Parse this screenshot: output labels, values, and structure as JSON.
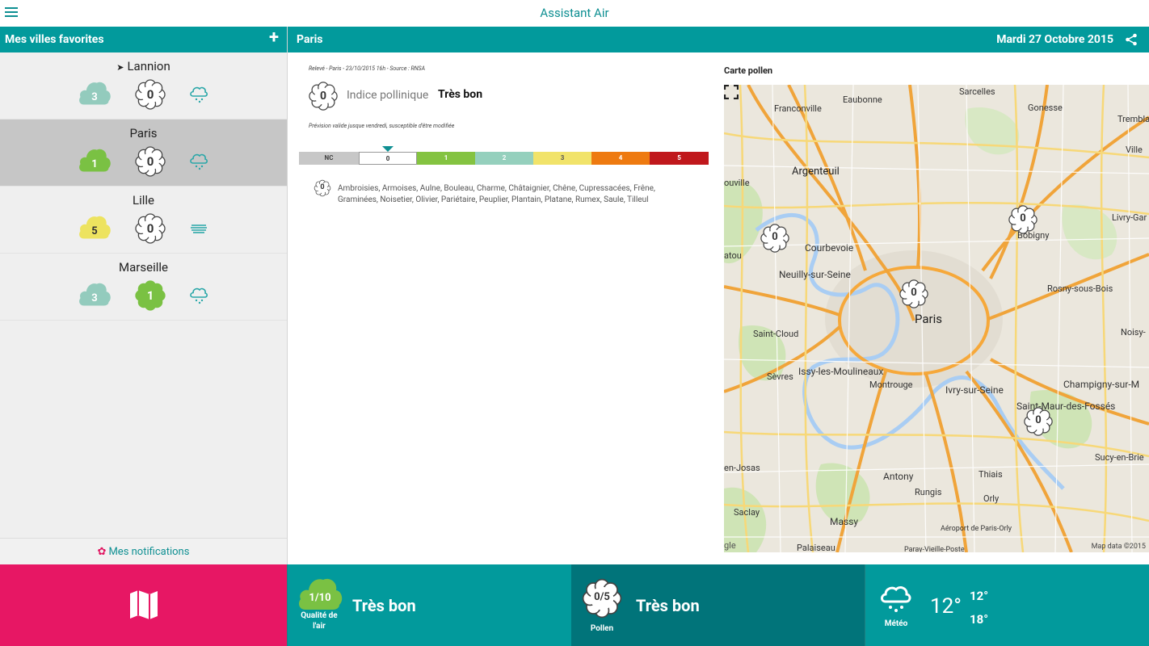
{
  "app": {
    "title": "Assistant Air"
  },
  "sidebar": {
    "title": "Mes villes favorites",
    "add_label": "+",
    "cities": [
      {
        "name": "Lannion",
        "located": true,
        "air": "3",
        "air_color": "#93cbbd",
        "pollen": "0",
        "pollen_color": "#ffffff",
        "weather": "rain-icon",
        "selected": false
      },
      {
        "name": "Paris",
        "located": false,
        "air": "1",
        "air_color": "#7ac143",
        "pollen": "0",
        "pollen_color": "#ffffff",
        "weather": "rain-icon",
        "selected": true
      },
      {
        "name": "Lille",
        "located": false,
        "air": "5",
        "air_color": "#ede35f",
        "pollen": "0",
        "pollen_color": "#ffffff",
        "weather": "fog-icon",
        "selected": false
      },
      {
        "name": "Marseille",
        "located": false,
        "air": "3",
        "air_color": "#93cbbd",
        "pollen": "1",
        "pollen_color": "#7ac143",
        "weather": "rain-icon",
        "selected": false
      }
    ],
    "notifications_label": "Mes notifications"
  },
  "main": {
    "city": "Paris",
    "date": "Mardi 27 Octobre 2015",
    "releve": "Relevé - Paris - 23/10/2015 16h - Source : RNSA",
    "index_value": "0",
    "index_label": "Indice pollinique",
    "index_quality": "Très bon",
    "prevision": "Prévision valide jusque vendredi, susceptible d'être modifiée",
    "scale": [
      {
        "label": "NC",
        "color": "#c7c7c7",
        "text_color": "#444"
      },
      {
        "label": "0",
        "color": "#ffffff",
        "text_color": "#333"
      },
      {
        "label": "1",
        "color": "#84c341",
        "text_color": "#fff"
      },
      {
        "label": "2",
        "color": "#95d0bd",
        "text_color": "#fff"
      },
      {
        "label": "3",
        "color": "#f1e36a",
        "text_color": "#555"
      },
      {
        "label": "4",
        "color": "#ee7a10",
        "text_color": "#fff"
      },
      {
        "label": "5",
        "color": "#c0181c",
        "text_color": "#fff"
      }
    ],
    "species_value": "0",
    "species": "Ambroisies, Armoises, Aulne, Bouleau, Charme, Châtaignier, Chêne, Cupressacées, Frêne, Graminées, Noisetier, Olivier, Pariétaire, Peuplier, Plantain, Platane, Rumex, Saule, Tilleul",
    "map_title": "Carte pollen",
    "map_data": "Map data ©2015",
    "map_logo": "gle",
    "map_labels": {
      "l1": "Sarcelles",
      "l2": "Franconville",
      "l3": "Eaubonne",
      "l4": "Gonesse",
      "l5": "Trembla",
      "l6": "Ville",
      "l7": "Argenteuil",
      "l8": "ouville",
      "l9": "Livry-Gar",
      "l10": "Courbevoie",
      "l11": "Bobigny",
      "l12": "Neuilly-sur-Seine",
      "l13": "Rosny-sous-Bois",
      "l14": "Paris",
      "l15": "Saint-Cloud",
      "l16": "Noisy-",
      "l17": "Issy-les-Moulineaux",
      "l18": "Champigny-sur-M",
      "l19": "Sèvres",
      "l20": "Montrouge",
      "l21": "Ivry-sur-Seine",
      "l22": "Saint-Maur-des-Fossés",
      "l23": "en-Josas",
      "l24": "Sucy-en-Brie",
      "l25": "Antony",
      "l26": "Thiais",
      "l27": "Rungis",
      "l28": "Orly",
      "l29": "Saclay",
      "l30": "Massy",
      "l31": "Aéroport de Paris-Orly",
      "l32": "Palaiseau",
      "l33": "Paray-Vieille-Poste",
      "l34": "atou"
    },
    "map_markers": [
      "0",
      "0",
      "0",
      "0"
    ]
  },
  "bottom": {
    "air_value": "1/10",
    "air_label_1": "Qualité de",
    "air_label_2": "l'air",
    "air_quality": "Très bon",
    "pollen_value": "0/5",
    "pollen_label": "Pollen",
    "pollen_quality": "Très bon",
    "meteo_label": "Météo",
    "temp": "12°",
    "temp_min": "12°",
    "temp_max": "18°"
  }
}
